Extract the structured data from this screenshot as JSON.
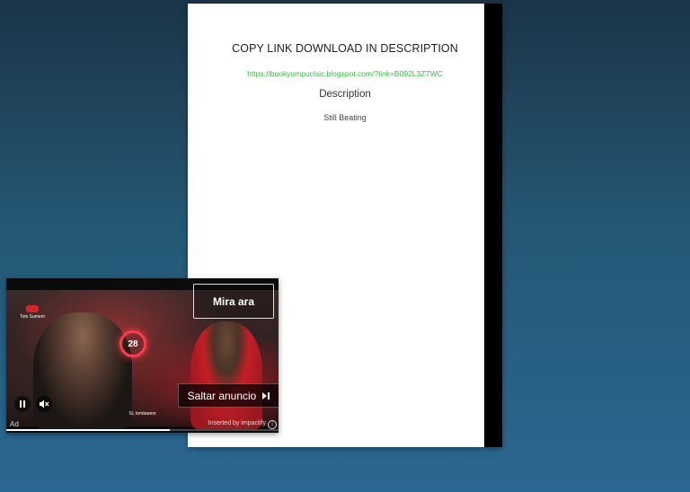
{
  "document": {
    "title": "COPY LINK DOWNLOAD IN DESCRIPTION",
    "link": "https://bookyumpuclsic.blogspot.com/?link=B092L3ZTWC",
    "description_heading": "Description",
    "description_text": "Still Beating"
  },
  "ad": {
    "cta_label": "Mira ara",
    "skip_label": "Saltar anuncio",
    "ad_label": "Ad",
    "powered_by": "Inserted by impactify",
    "subtitle": "Sí, tombarem",
    "brand": "Tots Sumem",
    "neon_number": "28",
    "progress": 0.6,
    "icons": {
      "pause": "pause-icon",
      "mute": "volume-mute-icon",
      "skip": "skip-next-icon",
      "info": "info-icon"
    }
  },
  "colors": {
    "link": "#2fbf3a",
    "background_top": "#1b3447",
    "background_bottom": "#2c6791"
  }
}
